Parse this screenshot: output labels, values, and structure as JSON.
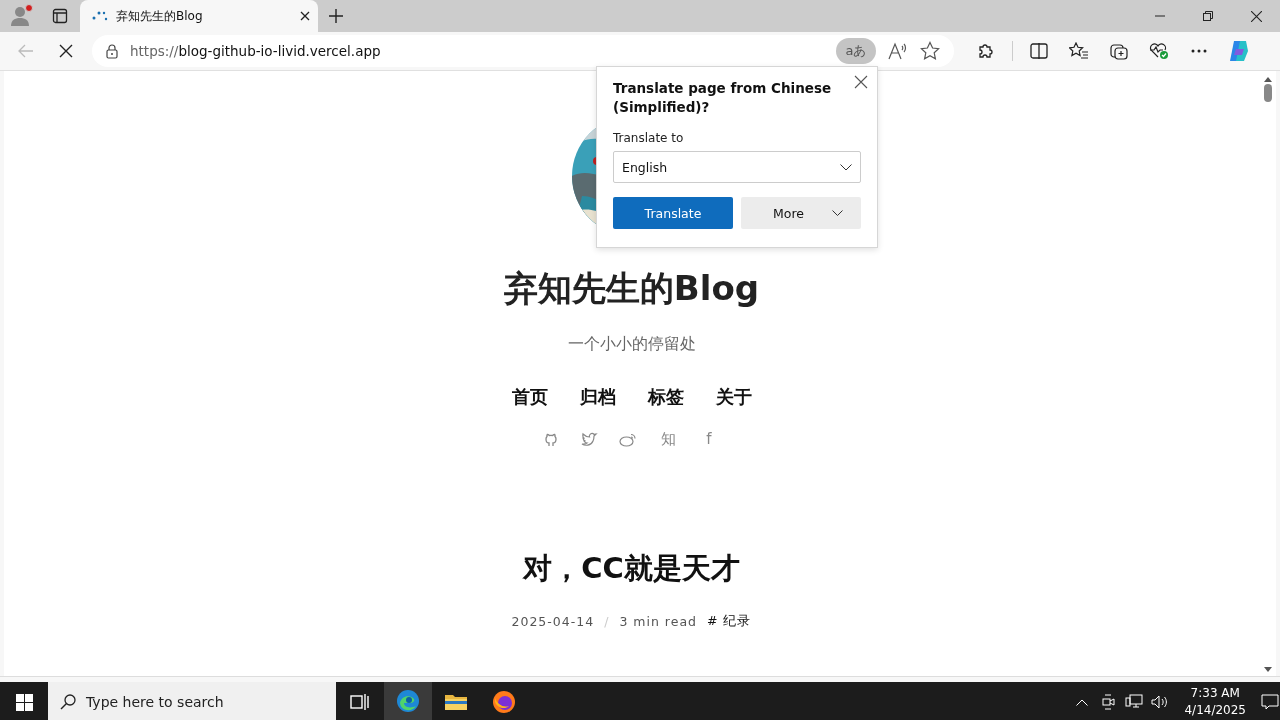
{
  "browser": {
    "tab": {
      "title": "弃知先生的Blog",
      "selected": true
    },
    "address": {
      "scheme": "https://",
      "host": "blog-github-io-livid.vercel.app"
    },
    "translate_button": {
      "label": "aあ",
      "selected": true
    }
  },
  "translate_popup": {
    "title": "Translate page from Chinese (Simplified)?",
    "field_label": "Translate to",
    "language": "English",
    "primary_button": "Translate",
    "secondary_button": "More"
  },
  "blog": {
    "title": "弃知先生的Blog",
    "subtitle": "一个小小的停留处",
    "nav": [
      "首页",
      "归档",
      "标签",
      "关于"
    ],
    "social": [
      {
        "kind": "github"
      },
      {
        "kind": "twitter"
      },
      {
        "kind": "weibo"
      },
      {
        "kind": "text",
        "text": "知"
      },
      {
        "kind": "text",
        "text": "f"
      }
    ],
    "post": {
      "title": "对，CC就是天才",
      "date": "2025-04-14",
      "separator": "/",
      "read_time": "3 min read",
      "tag": "# 纪录"
    }
  },
  "taskbar": {
    "search_placeholder": "Type here to search",
    "apps": [
      {
        "kind": "taskview",
        "selected": false
      },
      {
        "kind": "edge",
        "selected": true
      },
      {
        "kind": "folder",
        "selected": false
      },
      {
        "kind": "firefox",
        "selected": false
      }
    ],
    "time": "7:33 AM",
    "date": "4/14/2025"
  }
}
